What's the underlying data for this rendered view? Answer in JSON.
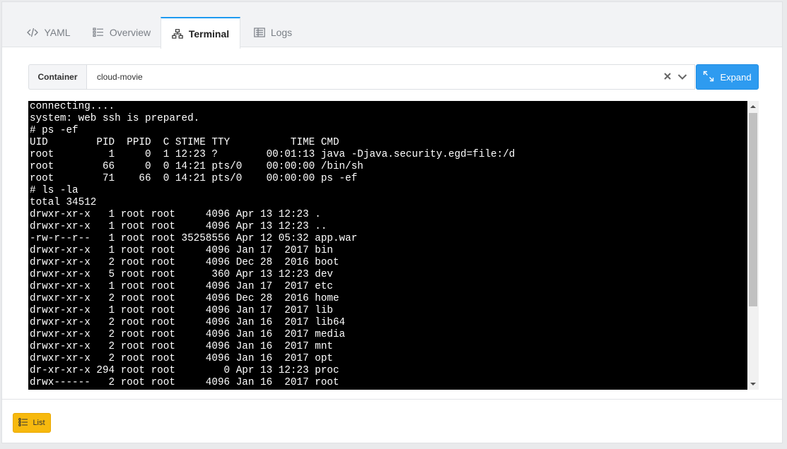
{
  "tabs": [
    {
      "label": "YAML",
      "icon": "code-icon",
      "active": false
    },
    {
      "label": "Overview",
      "icon": "list-icon",
      "active": false
    },
    {
      "label": "Terminal",
      "icon": "network-icon",
      "active": true
    },
    {
      "label": "Logs",
      "icon": "log-icon",
      "active": false
    }
  ],
  "container": {
    "label": "Container",
    "value": "cloud-movie",
    "expand_label": "Expand"
  },
  "terminal": {
    "lines": [
      "connecting....",
      "system: web ssh is prepared.",
      "# ps -ef",
      "UID        PID  PPID  C STIME TTY          TIME CMD",
      "root         1     0  1 12:23 ?        00:01:13 java -Djava.security.egd=file:/d",
      "root        66     0  0 14:21 pts/0    00:00:00 /bin/sh",
      "root        71    66  0 14:21 pts/0    00:00:00 ps -ef",
      "# ls -la",
      "total 34512",
      "drwxr-xr-x   1 root root     4096 Apr 13 12:23 .",
      "drwxr-xr-x   1 root root     4096 Apr 13 12:23 ..",
      "-rw-r--r--   1 root root 35258556 Apr 12 05:32 app.war",
      "drwxr-xr-x   1 root root     4096 Jan 17  2017 bin",
      "drwxr-xr-x   2 root root     4096 Dec 28  2016 boot",
      "drwxr-xr-x   5 root root      360 Apr 13 12:23 dev",
      "drwxr-xr-x   1 root root     4096 Jan 17  2017 etc",
      "drwxr-xr-x   2 root root     4096 Dec 28  2016 home",
      "drwxr-xr-x   1 root root     4096 Jan 17  2017 lib",
      "drwxr-xr-x   2 root root     4096 Jan 16  2017 lib64",
      "drwxr-xr-x   2 root root     4096 Jan 16  2017 media",
      "drwxr-xr-x   2 root root     4096 Jan 16  2017 mnt",
      "drwxr-xr-x   2 root root     4096 Jan 16  2017 opt",
      "dr-xr-xr-x 294 root root        0 Apr 13 12:23 proc",
      "drwx------   2 root root     4096 Jan 16  2017 root"
    ]
  },
  "footer": {
    "list_label": "List"
  },
  "colors": {
    "accent": "#2e9bf0",
    "list_button": "#f7b90e",
    "terminal_bg": "#000000",
    "terminal_fg": "#ffffff"
  }
}
